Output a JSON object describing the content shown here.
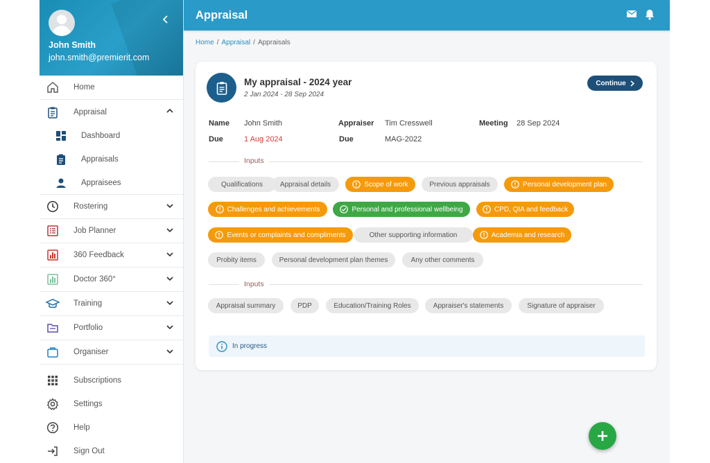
{
  "user": {
    "name": "John Smith",
    "email": "john.smith@premierit.com"
  },
  "sidebar": {
    "items": [
      {
        "label": "Home"
      },
      {
        "label": "Appraisal"
      },
      {
        "label": "Rostering"
      },
      {
        "label": "Job Planner"
      },
      {
        "label": "360 Feedback"
      },
      {
        "label": "Doctor 360°"
      },
      {
        "label": "Training"
      },
      {
        "label": "Portfolio"
      },
      {
        "label": "Organiser"
      }
    ],
    "sub_items": [
      {
        "label": "Dashboard"
      },
      {
        "label": "Appraisals"
      },
      {
        "label": "Appraisees"
      }
    ],
    "bottom_items": [
      {
        "label": "Subscriptions"
      },
      {
        "label": "Settings"
      },
      {
        "label": "Help"
      },
      {
        "label": "Sign Out"
      }
    ]
  },
  "header": {
    "title": "Appraisal"
  },
  "breadcrumb": {
    "home": "Home",
    "appraisal": "Appraisal",
    "current": "Appraisals"
  },
  "card": {
    "title": "My appraisal - 2024 year",
    "dates": "2 Jan 2024 - 28 Sep 2024",
    "continue_label": "Continue",
    "info": {
      "name_label": "Name",
      "name_value": "John Smith",
      "appraiser_label": "Appraiser",
      "appraiser_value": "Tim Cresswell",
      "meeting_label": "Meeting",
      "meeting_value": "28 Sep 2024",
      "due_label": "Due",
      "due_value": "1 Aug 2024",
      "due2_label": "Due",
      "due2_value": "MAG-2022"
    },
    "section1_label": "Inputs",
    "section2_label": "Inputs",
    "chips1": [
      {
        "label": "Qualifications",
        "status": "grey"
      },
      {
        "label": "Appraisal details",
        "status": "grey"
      },
      {
        "label": "Scope of work",
        "status": "orange"
      },
      {
        "label": "Previous appraisals",
        "status": "grey"
      },
      {
        "label": "Personal development plan",
        "status": "orange"
      },
      {
        "label": "Challenges and achievements",
        "status": "orange"
      },
      {
        "label": "Personal and professional wellbeing",
        "status": "green"
      },
      {
        "label": "CPD, QIA and feedback",
        "status": "orange"
      },
      {
        "label": "Events or complaints and compliments",
        "status": "orange"
      },
      {
        "label": "Other supporting information",
        "status": "grey"
      },
      {
        "label": "Academia and research",
        "status": "orange"
      },
      {
        "label": "Probity items",
        "status": "grey"
      },
      {
        "label": "Personal development plan themes",
        "status": "grey"
      },
      {
        "label": "Any other comments",
        "status": "grey"
      }
    ],
    "chips2": [
      {
        "label": "Appraisal summary",
        "status": "grey"
      },
      {
        "label": "PDP",
        "status": "grey"
      },
      {
        "label": "Education/Training Roles",
        "status": "grey"
      },
      {
        "label": "Appraiser's statements",
        "status": "grey"
      },
      {
        "label": "Signature of appraiser",
        "status": "grey"
      }
    ],
    "status_text": "In progress"
  },
  "colors": {
    "primary": "#2a9ac8",
    "dark_blue": "#1d4f79",
    "orange": "#f59a0c",
    "green": "#3fa845",
    "fab": "#28a745"
  },
  "icons": [
    "home-icon",
    "clipboard-icon",
    "dashboard-icon",
    "person-icon",
    "clock-icon",
    "list-icon",
    "chart-icon",
    "graduation-cap-icon",
    "folder-icon",
    "briefcase-icon",
    "grid-icon",
    "gear-icon",
    "help-icon",
    "sign-out-icon",
    "mail-icon",
    "bell-icon",
    "plus-icon",
    "info-icon",
    "warning-icon",
    "check-icon"
  ]
}
